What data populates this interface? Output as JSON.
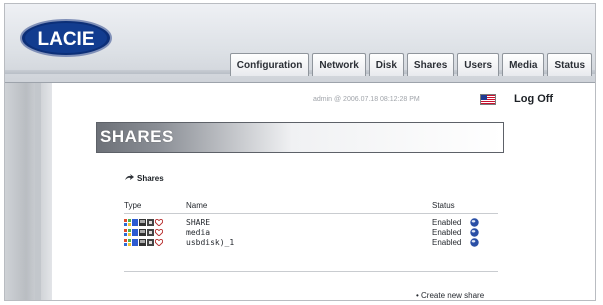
{
  "brand": {
    "logo_text": "LACIE"
  },
  "nav": {
    "tabs": [
      "Configuration",
      "Network",
      "Disk",
      "Shares",
      "Users",
      "Media",
      "Status"
    ]
  },
  "top": {
    "session": "admin @ 2006.07.18 08:12:28 PM",
    "logoff": "Log Off"
  },
  "page": {
    "title": "SHARES",
    "section": "Shares",
    "columns": {
      "type": "Type",
      "name": "Name",
      "status": "Status"
    },
    "rows": [
      {
        "name": "SHARE",
        "status": "Enabled"
      },
      {
        "name": "media",
        "status": "Enabled"
      },
      {
        "name": "usbdisk)_1",
        "status": "Enabled"
      }
    ],
    "create_link": "• Create new share"
  },
  "colors": {
    "accent": "#6d7178",
    "link_globe": "#2a4fa6"
  }
}
